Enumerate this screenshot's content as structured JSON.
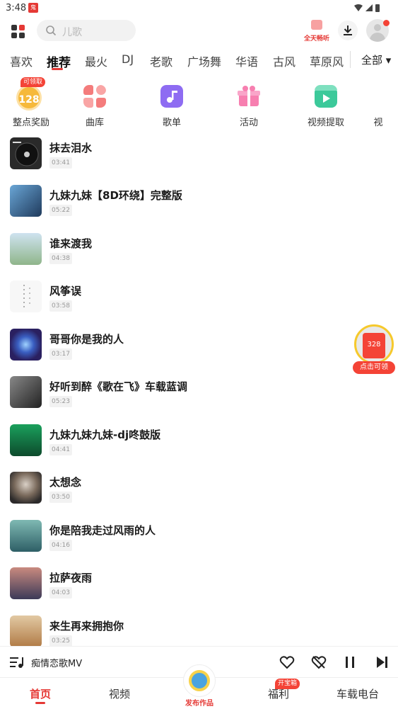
{
  "status_bar": {
    "time": "3:48",
    "app_badge": "鬼"
  },
  "header": {
    "search_placeholder": "儿歌",
    "vip_label": "全天畅听"
  },
  "tabs": [
    {
      "label": "喜欢",
      "active": false
    },
    {
      "label": "推荐",
      "active": true
    },
    {
      "label": "最火",
      "active": false
    },
    {
      "label": "DJ",
      "active": false
    },
    {
      "label": "老歌",
      "active": false
    },
    {
      "label": "广场舞",
      "active": false
    },
    {
      "label": "华语",
      "active": false
    },
    {
      "label": "古风",
      "active": false
    },
    {
      "label": "草原风",
      "active": false
    }
  ],
  "tab_all": "全部",
  "quick_items": [
    {
      "label": "整点奖励",
      "icon": "coin-icon",
      "coin_value": "128",
      "tag": "可领取"
    },
    {
      "label": "曲库",
      "icon": "library-icon"
    },
    {
      "label": "歌单",
      "icon": "playlist-icon"
    },
    {
      "label": "活动",
      "icon": "gift-icon"
    },
    {
      "label": "视频提取",
      "icon": "video-extract-icon"
    },
    {
      "label": "视",
      "icon": "video-icon"
    }
  ],
  "songs": [
    {
      "title": "抹去泪水",
      "duration": "03:41",
      "cover_color": "#2a2a2a"
    },
    {
      "title": "九妹九妹【8D环绕】完整版",
      "duration": "05:22",
      "cover_color": "#3b6e9c"
    },
    {
      "title": "谁来渡我",
      "duration": "04:38",
      "cover_color": "#8fb58a"
    },
    {
      "title": "风筝误",
      "duration": "03:58",
      "cover_color": "#f4f4f4"
    },
    {
      "title": "哥哥你是我的人",
      "duration": "03:17",
      "cover_color": "#4a64b8"
    },
    {
      "title": "好听到醉《歌在飞》车载蓝调",
      "duration": "05:23",
      "cover_color": "#3a3a3a"
    },
    {
      "title": "九妹九妹九妹-dj咚鼓版",
      "duration": "04:41",
      "cover_color": "#1aa05c"
    },
    {
      "title": "太想念",
      "duration": "03:50",
      "cover_color": "#5a4a3e"
    },
    {
      "title": "你是陪我走过风雨的人",
      "duration": "04:16",
      "cover_color": "#3f7f86"
    },
    {
      "title": "拉萨夜雨",
      "duration": "04:03",
      "cover_color": "#8b5e56"
    },
    {
      "title": "来生再来拥抱你",
      "duration": "03:25",
      "cover_color": "#c9935b"
    }
  ],
  "float_reward": {
    "amount": "328",
    "label": "点击可领"
  },
  "player": {
    "now_playing": "痴情恋歌MV"
  },
  "bottom_nav": {
    "items": [
      "首页",
      "视频",
      "福利",
      "车载电台"
    ],
    "publish_label": "发布作品",
    "welfare_badge": "开宝箱"
  },
  "colors": {
    "accent": "#e53935",
    "text": "#222222",
    "muted": "#999999"
  }
}
